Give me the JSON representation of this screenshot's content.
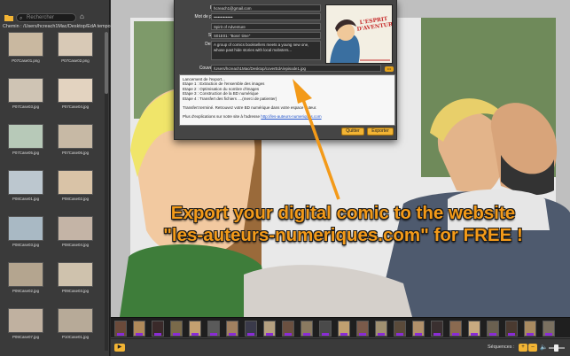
{
  "sidebar": {
    "search_placeholder": "Rechercher",
    "home_icon": "⌂",
    "path_label": "Chemin : /Users/hcreach1Mac/Desktop/EdA temporaire",
    "thumbnails": [
      {
        "caption": "P07Case01.png",
        "color": "#c9b8a0"
      },
      {
        "caption": "P07Case02.png",
        "color": "#d8c9b6"
      },
      {
        "caption": "P07Case03.jpg",
        "color": "#cfc4b4"
      },
      {
        "caption": "P07Case04.jpg",
        "color": "#e3d3c0"
      },
      {
        "caption": "P07Case05.jpg",
        "color": "#b7c9b8"
      },
      {
        "caption": "P07Case06.jpg",
        "color": "#c7b9a5"
      },
      {
        "caption": "P08Case01.jpg",
        "color": "#bcc7cf"
      },
      {
        "caption": "P08Case02.jpg",
        "color": "#d9c3a7"
      },
      {
        "caption": "P08Case03.jpg",
        "color": "#a9b9c4"
      },
      {
        "caption": "P08Case04.jpg",
        "color": "#c4b4a6"
      },
      {
        "caption": "P09Case02.jpg",
        "color": "#b4a58f"
      },
      {
        "caption": "P09Case03.jpg",
        "color": "#cfc2ad"
      },
      {
        "caption": "P09Case07.jpg",
        "color": "#c0b1a0"
      },
      {
        "caption": "P10Case01.jpg",
        "color": "#b7aa98"
      }
    ]
  },
  "dialog": {
    "email_label": "Email (*) :",
    "email_value": "hcreach1@gmail.com",
    "password_label": "Mot de passe (*) :",
    "password_value": "••••••••••••••",
    "title_label": "Titre (*) :",
    "title_value": "Spirit of Adventure",
    "subtitle_label": "Sous-titre :",
    "subtitle_value": "S01E01: \"Boss' time\"",
    "description_label": "Description :",
    "description_value": "A group of comics booksellers meets a young new one, whose past hide stories with local mobsters...",
    "cover_label": "Couverture (*) :",
    "cover_value": "/Users/hcreach1Mac/Desktop/coverEdA/episode1.jpg",
    "cover_button": "•••",
    "cover_art_title": "L'ESPRIT D'AVENTURE",
    "log": {
      "line1": "Lancement de l'export...",
      "line2": "Etape 1 : Extraction de l'ensemble des images",
      "line3": "Etape 2 : Optimisation du nombre d'images",
      "line4": "Etape 3 : Construction de la BD numérique",
      "line5": "Etape 4 : Transfert des fichiers ....(merci de patienter)",
      "line6": "Transfert terminé. Retrouvez votre BD numérique dans votre espace auteur.",
      "line7": "Plus d'explications sur notre site à l'adresse",
      "link": "http://les-auteurs-numeriques.com"
    },
    "quit_button": "Quitter",
    "export_button": "Exporter"
  },
  "promo": {
    "line1": "Export your digital comic to the website",
    "line2": "\"les-auteurs-numeriques.com\" for FREE !",
    "color": "#f39a19"
  },
  "timeline": {
    "frames": [
      "#6a4a3a",
      "#b08a5a",
      "#3a2a2a",
      "#7a6a4a",
      "#c4a070",
      "#5a5a5a",
      "#a08060",
      "#3a3a4a",
      "#b4a080",
      "#6a5040",
      "#8a7a60",
      "#4a4a4a",
      "#c0a070",
      "#7a5a4a",
      "#a09070",
      "#5a4a3a",
      "#b0906a",
      "#3a3030",
      "#8a6a50",
      "#c8aa80",
      "#6a6050",
      "#4a3a30",
      "#a88a60",
      "#7a7060"
    ]
  },
  "bottombar": {
    "play_icon": "▶",
    "sequences_label": "Séquences :",
    "add_icon": "+",
    "remove_icon": "–",
    "speaker_icon": "🔈"
  },
  "colors": {
    "accent": "#f2b434",
    "purple_badge": "#8a2bd6"
  }
}
